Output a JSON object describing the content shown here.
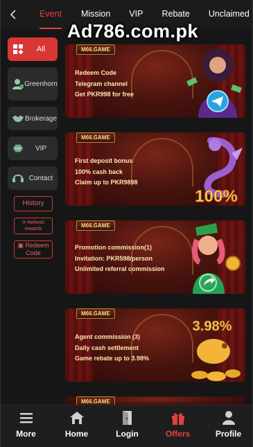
{
  "header": {
    "tabs": [
      {
        "label": "Event",
        "active": true
      },
      {
        "label": "Mission",
        "active": false
      },
      {
        "label": "VIP",
        "active": false
      },
      {
        "label": "Rebate",
        "active": false
      },
      {
        "label": "Unclaimed",
        "active": false
      }
    ],
    "watermark": "Ad786.com.pk"
  },
  "sidebar": {
    "items": [
      {
        "label": "All",
        "icon": "grid-icon",
        "active": true
      },
      {
        "label": "Greenhorn",
        "icon": "newbie-icon",
        "active": false
      },
      {
        "label": "Brokerage",
        "icon": "handshake-icon",
        "active": false
      },
      {
        "label": "VIP",
        "icon": "vip-badge-icon",
        "active": false
      },
      {
        "label": "Contact",
        "icon": "support-icon",
        "active": false
      }
    ],
    "links": {
      "history": "History",
      "refresh": "Refresh rewards",
      "redeem": "Redeem Code"
    }
  },
  "promos": [
    {
      "brand": "M66.GAME",
      "lines": [
        "Redeem Code",
        "Telegram channel",
        "Get PKR998 for free"
      ],
      "art": "telegram-icon"
    },
    {
      "brand": "M66.GAME",
      "lines": [
        "First deposit bonus",
        "100% cash back",
        "Claim up to PKR9898"
      ],
      "art": "dragon-icon",
      "art_text": "100%"
    },
    {
      "brand": "M66.GAME",
      "lines": [
        "Promotion commission(1)",
        "Invitation: PKR598/person",
        "Unlimited referral commission"
      ],
      "art": "share-icon"
    },
    {
      "brand": "M66.GAME",
      "lines": [
        "Agent commission (3)",
        "Daily cash settlement",
        "Game rebate up to 3.98%"
      ],
      "art": "piggy-icon",
      "art_text": "3.98%"
    },
    {
      "brand": "M66.GAME"
    }
  ],
  "bottom_nav": [
    {
      "label": "More",
      "icon": "menu-icon",
      "active": false
    },
    {
      "label": "Home",
      "icon": "home-icon",
      "active": false
    },
    {
      "label": "Login",
      "icon": "login-icon",
      "active": false
    },
    {
      "label": "Offers",
      "icon": "gift-icon",
      "active": true
    },
    {
      "label": "Profile",
      "icon": "user-icon",
      "active": false
    }
  ],
  "colors": {
    "accent": "#e34040",
    "background": "#161616",
    "card_text": "#ffe9b0"
  }
}
